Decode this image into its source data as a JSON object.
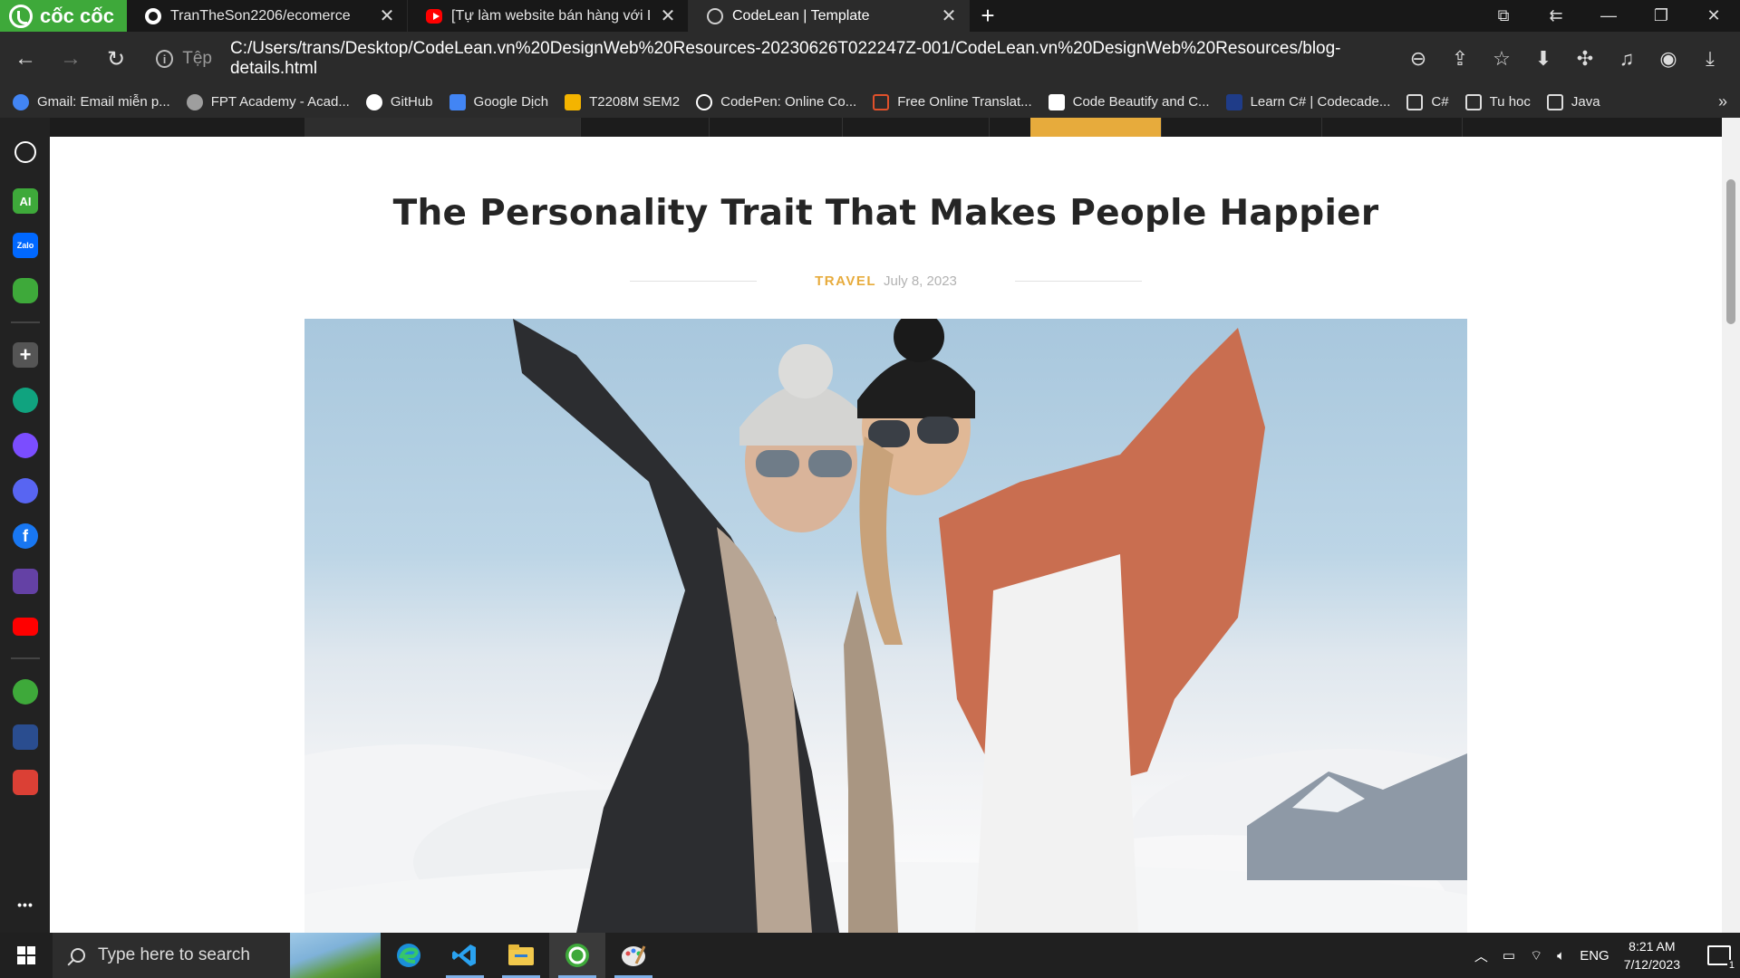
{
  "browser": {
    "brand": "cốc cốc",
    "tabs": [
      {
        "title": "TranTheSon2206/ecomerce",
        "favicon": "github-icon",
        "active": false
      },
      {
        "title": "[Tự làm website bán hàng với Lara",
        "favicon": "youtube-icon",
        "active": false
      },
      {
        "title": "CodeLean | Template",
        "favicon": "globe-icon",
        "active": true
      }
    ],
    "address": {
      "scheme_label": "Tệp",
      "url": "C:/Users/trans/Desktop/CodeLean.vn%20DesignWeb%20Resources-20230626T022247Z-001/CodeLean.vn%20DesignWeb%20Resources/blog-details.html"
    },
    "bookmarks": [
      {
        "label": "Gmail: Email miễn p...",
        "icon": "google-icon",
        "color": "#4285f4"
      },
      {
        "label": "FPT Academy - Acad...",
        "icon": "globe-icon",
        "color": "#9e9e9e"
      },
      {
        "label": "GitHub",
        "icon": "github-icon",
        "color": "#ffffff"
      },
      {
        "label": "Google Dịch",
        "icon": "google-translate-icon",
        "color": "#4285f4"
      },
      {
        "label": "T2208M SEM2",
        "icon": "classroom-icon",
        "color": "#f4b400"
      },
      {
        "label": "CodePen: Online Co...",
        "icon": "codepen-icon",
        "color": "#ffffff"
      },
      {
        "label": "Free Online Translat...",
        "icon": "translate-icon",
        "color": "#e0512b"
      },
      {
        "label": "Code Beautify and C...",
        "icon": "codebeautify-icon",
        "color": "#ffffff"
      },
      {
        "label": "Learn C# | Codecade...",
        "icon": "codecademy-icon",
        "color": "#1f3c88"
      },
      {
        "label": "C#",
        "icon": "folder-icon",
        "color": "#dddddd"
      },
      {
        "label": "Tu hoc",
        "icon": "folder-icon",
        "color": "#dddddd"
      },
      {
        "label": "Java",
        "icon": "folder-icon",
        "color": "#dddddd"
      }
    ],
    "more_bookmarks": "»"
  },
  "sidebar": {
    "items": [
      {
        "name": "history-icon",
        "label": "",
        "color": "#222222"
      },
      {
        "name": "ai-icon",
        "label": "AI",
        "color": "#3ea93a"
      },
      {
        "name": "zalo-icon",
        "label": "Zalo",
        "color": "#0068ff"
      },
      {
        "name": "game-icon",
        "label": "",
        "color": "#3ea93a"
      },
      {
        "name": "add-icon",
        "label": "+",
        "color": "#555555"
      },
      {
        "name": "chatgpt-icon",
        "label": "",
        "color": "#10a37f"
      },
      {
        "name": "messenger-icon",
        "label": "",
        "color": "#7b4dff"
      },
      {
        "name": "discord-icon",
        "label": "",
        "color": "#5865f2"
      },
      {
        "name": "facebook-icon",
        "label": "f",
        "color": "#1877f2"
      },
      {
        "name": "twitch-icon",
        "label": "",
        "color": "#6441a5"
      },
      {
        "name": "youtube-icon",
        "label": "",
        "color": "#ff0000"
      },
      {
        "name": "coccoc-icon",
        "label": "",
        "color": "#3ea93a"
      },
      {
        "name": "game-avatar-icon",
        "label": "",
        "color": "#2a4d8f"
      },
      {
        "name": "todoist-icon",
        "label": "",
        "color": "#db4035"
      },
      {
        "name": "more-icon",
        "label": "•••",
        "color": "#222222"
      }
    ]
  },
  "blog": {
    "title": "The Personality Trait That Makes People Happier",
    "category": "TRAVEL",
    "date": "July 8, 2023",
    "accent": "#e7ab3c"
  },
  "taskbar": {
    "search_placeholder": "Type here to search",
    "apps": [
      "edge-icon",
      "vscode-icon",
      "file-explorer-icon",
      "coccoc-icon",
      "paint-icon"
    ],
    "language": "ENG",
    "time": "8:21 AM",
    "date": "7/12/2023",
    "notification_count": "1"
  }
}
